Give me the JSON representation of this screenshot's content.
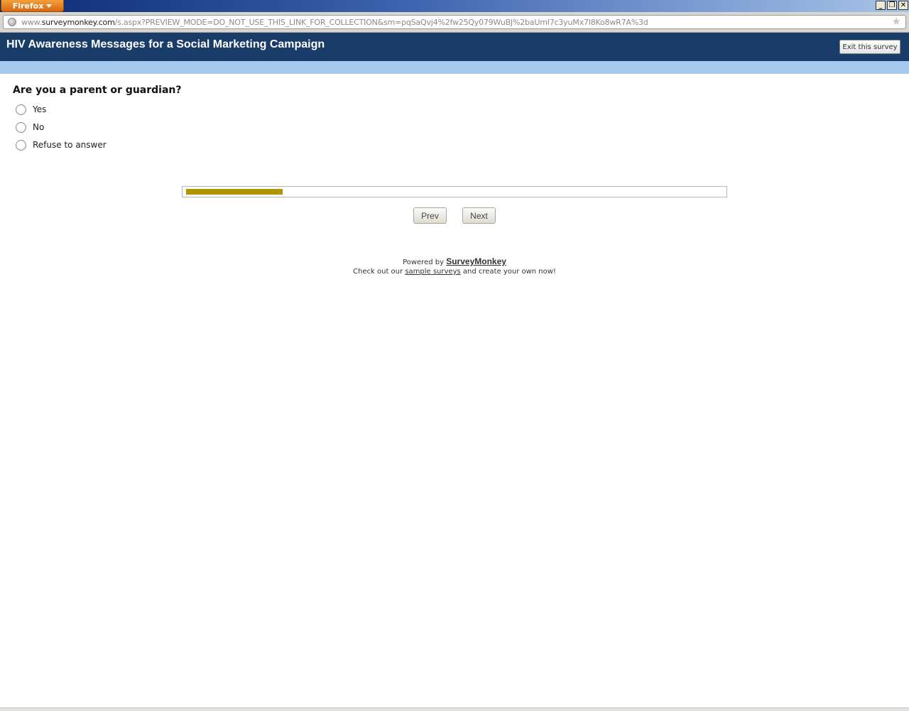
{
  "browser": {
    "menu_label": "Firefox",
    "url_prefix": "www.",
    "url_domain": "surveymonkey.com",
    "url_path": "/s.aspx?PREVIEW_MODE=DO_NOT_USE_THIS_LINK_FOR_COLLECTION&sm=pqSaQvj4%2fw25Qy079WuBJ%2baUmI7c3yuMx7I8Ko8wR7A%3d",
    "minimize_glyph": "_",
    "restore_glyph": "❐",
    "close_glyph": "✕",
    "bookmark_glyph": "★"
  },
  "survey": {
    "title": "HIV Awareness Messages for a Social Marketing Campaign",
    "exit_label": "Exit this survey",
    "question": "Are you a parent or guardian?",
    "options": [
      "Yes",
      "No",
      "Refuse to answer"
    ],
    "progress_fraction": 0.18,
    "progress_color": "#b09400",
    "prev_label": "Prev",
    "next_label": "Next"
  },
  "footer": {
    "powered_prefix": "Powered by",
    "brand": "SurveyMonkey",
    "checkout_prefix": "Check out our",
    "checkout_link": "sample surveys",
    "checkout_suffix": "and create your own now!"
  },
  "colors": {
    "header_bg": "#1a3c68",
    "subbar_bg": "#a9c8ee"
  }
}
